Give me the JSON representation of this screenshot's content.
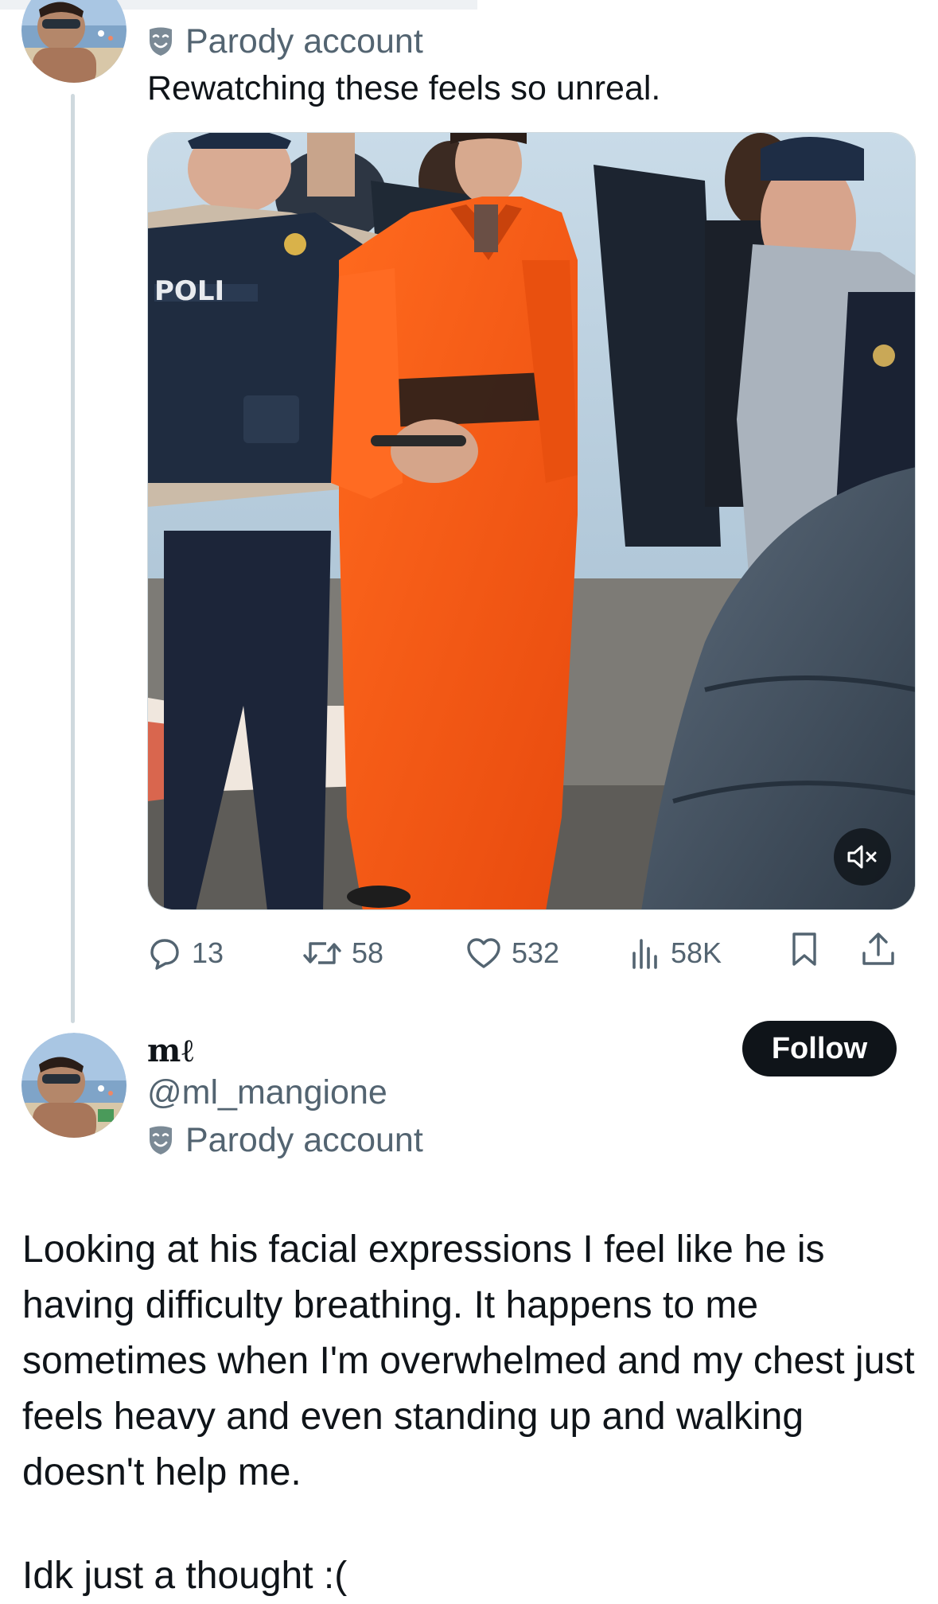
{
  "post1": {
    "parody_label": "Parody account",
    "text": "Rewatching these feels so unreal.",
    "media": {
      "vest_text": "POLI",
      "mute_icon": "speaker-muted-icon"
    },
    "actions": {
      "replies": "13",
      "reposts": "58",
      "likes": "532",
      "views": "58K"
    }
  },
  "post2": {
    "display_name": "mℓ",
    "handle": "@ml_mangione",
    "parody_label": "Parody account",
    "follow_label": "Follow",
    "body": [
      "Looking at his facial expressions I feel like he is having difficulty breathing. It happens to me sometimes when I'm overwhelmed and my chest just feels heavy and even standing up and walking doesn't help me."
    ],
    "after_text": "Idk just a thought :("
  },
  "icons": {
    "reply": "reply-icon",
    "repost": "repost-icon",
    "like": "heart-icon",
    "views": "views-icon",
    "bookmark": "bookmark-icon",
    "share": "share-icon",
    "parody": "parody-mask-icon"
  },
  "colors": {
    "text": "#0f1419",
    "secondary": "#536471",
    "thread_line": "#cfd9de",
    "jumpsuit": "#f45a16",
    "follow_bg": "#0f1419"
  }
}
